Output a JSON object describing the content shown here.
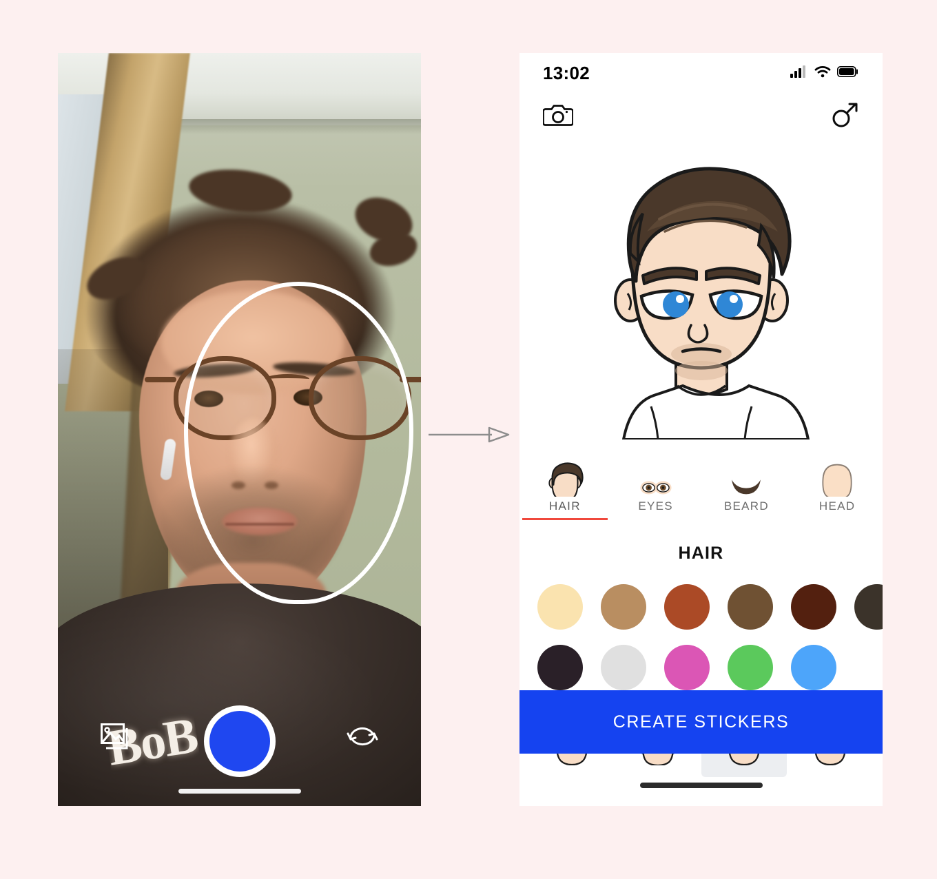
{
  "page": {
    "background_color": "#fdf0f0",
    "flow_arrow": "arrow-right"
  },
  "camera_screen": {
    "name": "selfie-camera-capture",
    "overlay_guide": "face-oval-guide",
    "sweater_text": "BoB",
    "controls": {
      "gallery_label": "gallery-icon",
      "shutter_label": "shutter-button",
      "shutter_color": "#1f47f0",
      "flip_label": "flip-camera-icon"
    }
  },
  "editor_screen": {
    "statusbar": {
      "time": "13:02",
      "signal": "signal-bars-icon",
      "wifi": "wifi-icon",
      "battery": "battery-full-icon"
    },
    "topbar": {
      "camera_button": "camera-icon",
      "gender_button": "male-gender-icon"
    },
    "avatar": {
      "name": "avatar-preview",
      "hair_color": "#4a382a",
      "skin_color": "#f8ddc6",
      "eye_color": "#2f87d6",
      "shirt_color": "#ffffff"
    },
    "tabs": [
      {
        "label": "HAIR",
        "icon": "hair-tab-icon",
        "active": true
      },
      {
        "label": "EYES",
        "icon": "eyes-tab-icon",
        "active": false
      },
      {
        "label": "BEARD",
        "icon": "beard-tab-icon",
        "active": false
      },
      {
        "label": "HEAD",
        "icon": "head-tab-icon",
        "active": false
      }
    ],
    "active_tab_underline_color": "#f0483c",
    "panel": {
      "title": "HAIR",
      "color_rows": [
        [
          "#fae3af",
          "#b98e61",
          "#ab4a26",
          "#6f5133",
          "#53200f",
          "#3b332a"
        ],
        [
          "#2a2028",
          "#e0e0e0",
          "#db56b5",
          "#5bc95c",
          "#4da5fa"
        ]
      ],
      "styles": [
        {
          "name": "hair-style-1",
          "selected": false
        },
        {
          "name": "hair-style-2",
          "selected": false
        },
        {
          "name": "hair-style-3",
          "selected": true
        },
        {
          "name": "hair-style-4",
          "selected": false
        }
      ]
    },
    "create_button": {
      "label": "CREATE STICKERS",
      "color": "#1543f0"
    }
  }
}
